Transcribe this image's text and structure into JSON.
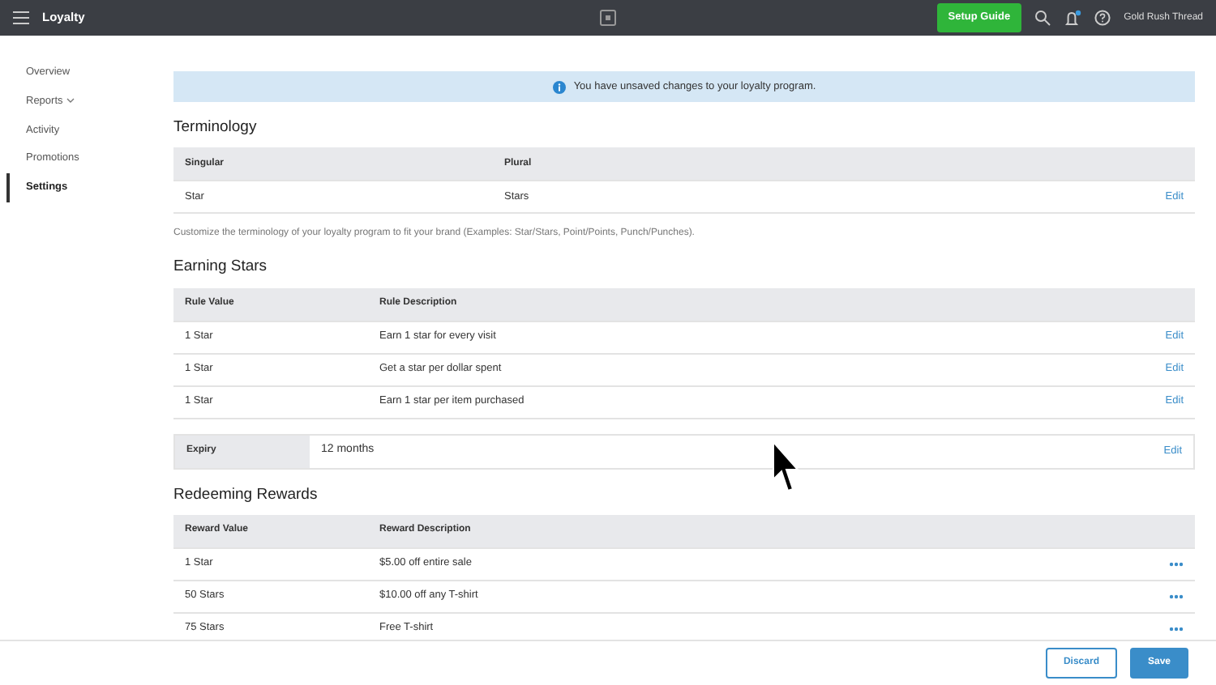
{
  "topbar": {
    "title": "Loyalty",
    "setup_button": "Setup Guide",
    "account": "Gold Rush Thread"
  },
  "sidebar": {
    "items": [
      {
        "label": "Overview",
        "selected": false,
        "has_caret": false
      },
      {
        "label": "Reports",
        "selected": false,
        "has_caret": true
      },
      {
        "label": "Activity",
        "selected": false,
        "has_caret": false
      },
      {
        "label": "Promotions",
        "selected": false,
        "has_caret": false
      },
      {
        "label": "Settings",
        "selected": true,
        "has_caret": false
      }
    ]
  },
  "alert": "You have unsaved changes to your loyalty program.",
  "terminology": {
    "heading": "Terminology",
    "columns": [
      "Singular",
      "Plural"
    ],
    "rows": [
      {
        "cells": [
          "Star",
          "Stars"
        ],
        "action": "Edit"
      }
    ],
    "note": "Customize the terminology of your loyalty program to fit your brand (Examples: Star/Stars, Point/Points, Punch/Punches)."
  },
  "earning": {
    "heading": "Earning Stars",
    "columns": [
      "Rule Value",
      "Rule Description"
    ],
    "rows": [
      {
        "cells": [
          "1 Star",
          "Earn 1 star for every visit"
        ],
        "action": "Edit"
      },
      {
        "cells": [
          "1 Star",
          "Get a star per dollar spent"
        ],
        "action": "Edit"
      },
      {
        "cells": [
          "1 Star",
          "Earn 1 star per item purchased"
        ],
        "action": "Edit"
      }
    ]
  },
  "expiry": {
    "label": "Expiry",
    "value": "12 months",
    "action": "Edit"
  },
  "rewards": {
    "heading": "Redeeming Rewards",
    "columns": [
      "Reward Value",
      "Reward Description"
    ],
    "rows": [
      {
        "cells": [
          "1 Star",
          "$5.00 off entire sale"
        ]
      },
      {
        "cells": [
          "50 Stars",
          "$10.00 off any T-shirt"
        ]
      },
      {
        "cells": [
          "75 Stars",
          "Free T-shirt"
        ]
      }
    ]
  },
  "footer": {
    "buttons": [
      {
        "label": "Discard",
        "kind": "secondary"
      },
      {
        "label": "Save",
        "kind": "primary"
      }
    ]
  }
}
